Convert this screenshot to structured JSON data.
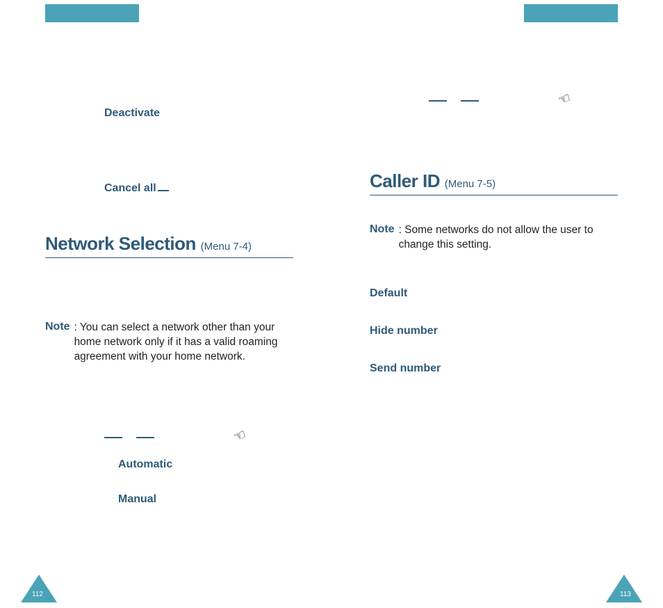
{
  "left": {
    "deactivate": "Deactivate",
    "cancel_all": "Cancel all",
    "section_title": "Network Selection",
    "section_menu": "(Menu 7-4)",
    "note_label": "Note",
    "note_text": ": You can select a network other than your home network only if it has a valid roaming agreement with your home network.",
    "automatic": "Automatic",
    "manual": "Manual",
    "page_num": "112"
  },
  "right": {
    "section_title": "Caller ID",
    "section_menu": "(Menu 7-5)",
    "note_label": "Note",
    "note_text": ": Some networks do not allow the user to change this setting.",
    "opt_default": "Default",
    "opt_hide": "Hide number",
    "opt_send": "Send number",
    "page_num": "113"
  }
}
